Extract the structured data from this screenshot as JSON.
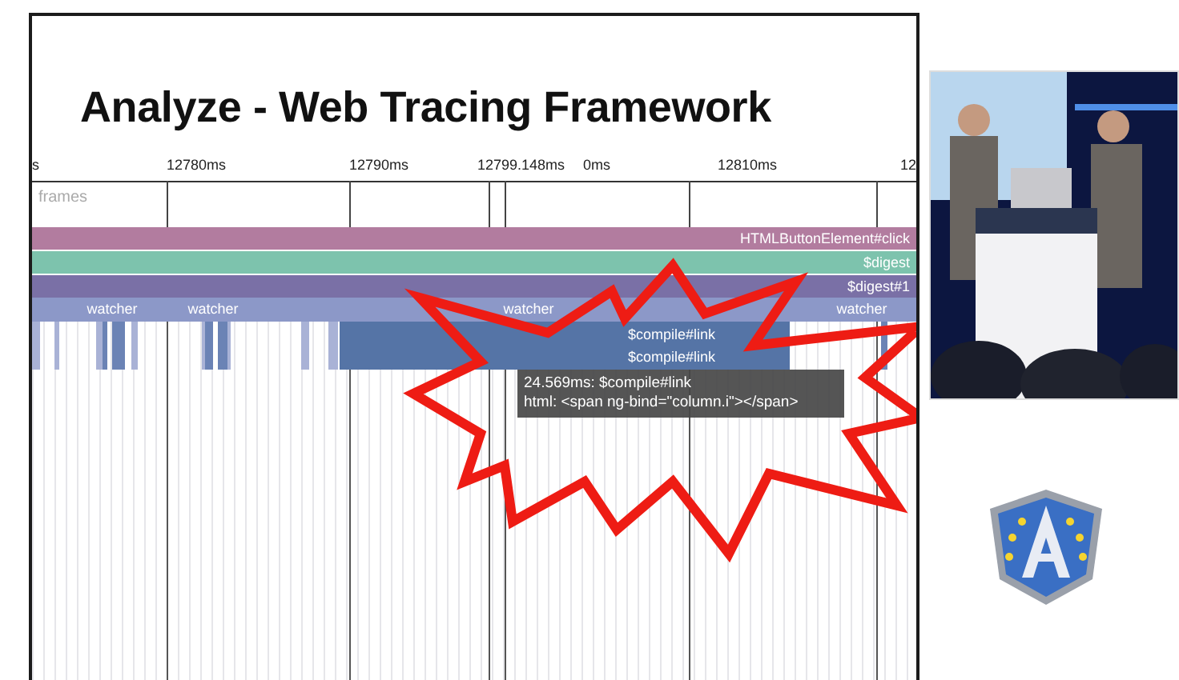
{
  "slide": {
    "title": "Analyze - Web Tracing Framework",
    "ruler": [
      "s",
      "12780ms",
      "12790ms",
      "12799.148ms",
      "0ms",
      "12810ms",
      "12"
    ],
    "frames_label": "frames",
    "tracks": [
      {
        "label": "HTMLButtonElement#click",
        "color": "#b27c9f"
      },
      {
        "label": "$digest",
        "color": "#7dc3ad"
      },
      {
        "label": "$digest#1",
        "color": "#7a70a6"
      }
    ],
    "watchers": [
      "watcher",
      "watcher",
      "watcher",
      "watcher"
    ],
    "compile_labels": [
      "$compile#link",
      "$compile#link"
    ],
    "tooltip": {
      "line_1": "24.569ms: $compile#link",
      "line_2": "html: <span ng-bind=\"column.i\"></span>"
    }
  }
}
